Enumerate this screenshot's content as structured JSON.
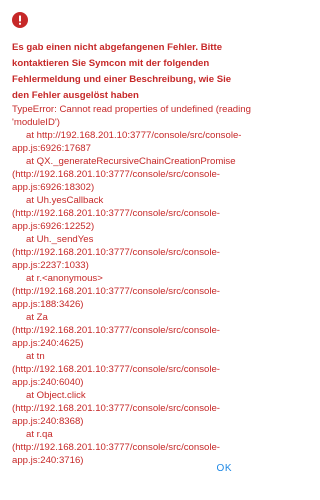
{
  "dialog": {
    "error_message": "Es gab einen nicht abgefangenen Fehler. Bitte kontaktieren Sie Symcon mit der folgenden Fehlermeldung und einer Beschreibung, wie Sie den Fehler ausgelöst haben",
    "trace_lines": [
      "TypeError: Cannot read properties of undefined (reading",
      "'moduleID')",
      "at http://192.168.201.10:3777/console/src/console-",
      "app.js:6926:17687",
      "at QX._generateRecursiveChainCreationPromise",
      "(http://192.168.201.10:3777/console/src/console-",
      "app.js:6926:18302)",
      "at Uh.yesCallback",
      "(http://192.168.201.10:3777/console/src/console-",
      "app.js:6926:12252)",
      "at Uh._sendYes",
      "(http://192.168.201.10:3777/console/src/console-",
      "app.js:2237:1033)",
      "at r.<anonymous>",
      "(http://192.168.201.10:3777/console/src/console-",
      "app.js:188:3426)",
      "at Za",
      "(http://192.168.201.10:3777/console/src/console-",
      "app.js:240:4625)",
      "at tn",
      "(http://192.168.201.10:3777/console/src/console-",
      "app.js:240:6040)",
      "at Object.click",
      "(http://192.168.201.10:3777/console/src/console-",
      "app.js:240:8368)",
      "at r.qa",
      "(http://192.168.201.10:3777/console/src/console-",
      "app.js:240:3716)"
    ],
    "ok_label": "OK",
    "icon": "error-icon",
    "colors": {
      "error": "#c62828",
      "accent": "#1e88e5"
    }
  }
}
